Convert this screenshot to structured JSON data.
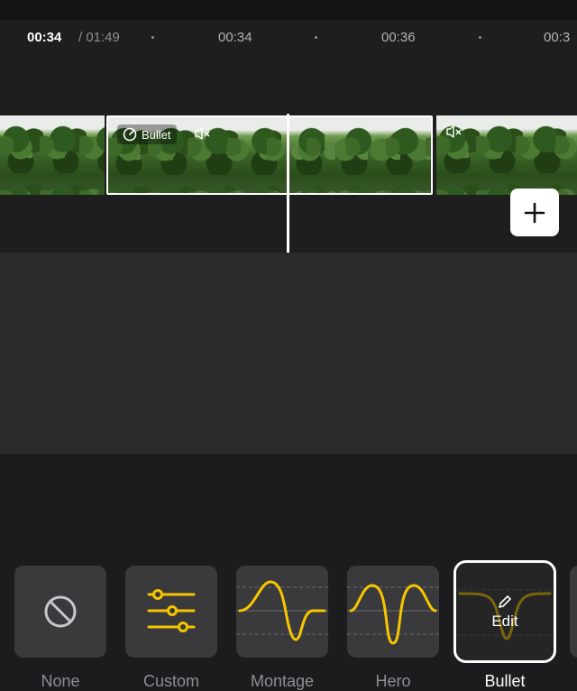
{
  "ruler": {
    "current_time": "00:34",
    "total_time": "/ 01:49",
    "ticks": [
      "00:34",
      "00:36",
      "00:3"
    ]
  },
  "timeline": {
    "selected_clip_label": "Bullet"
  },
  "speed_panel": {
    "selected": "Bullet",
    "edit_label": "Edit",
    "accent_color": "#f7c600",
    "options": [
      {
        "label": "None",
        "icon": "prohibited-icon"
      },
      {
        "label": "Custom",
        "icon": "sliders-icon"
      },
      {
        "label": "Montage",
        "icon": "montage-curve-icon"
      },
      {
        "label": "Hero",
        "icon": "hero-curve-icon"
      },
      {
        "label": "Bullet",
        "icon": "bullet-curve-icon"
      }
    ]
  }
}
